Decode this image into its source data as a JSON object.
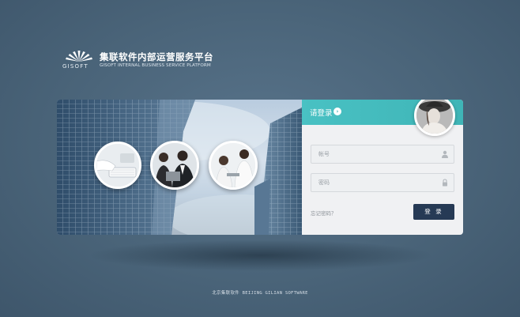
{
  "brand": {
    "logo_word": "GISOFT",
    "title": "集联软件内部运营服务平台",
    "subtitle": "GISOFT INTERNAL BUSINESS SERVICE PLATFORM"
  },
  "login": {
    "title": "请登录",
    "arrow_icon": "chevron-right-icon",
    "account_placeholder": "帐号",
    "password_placeholder": "密码",
    "forgot_label": "忘记密码？",
    "submit_label": "登 录"
  },
  "footer": {
    "text": "北京集联软件 BEIJING GILIAN SOFTWARE"
  },
  "colors": {
    "background": "#4a6479",
    "accent_teal": "#3fb5b7",
    "button": "#263a55"
  }
}
